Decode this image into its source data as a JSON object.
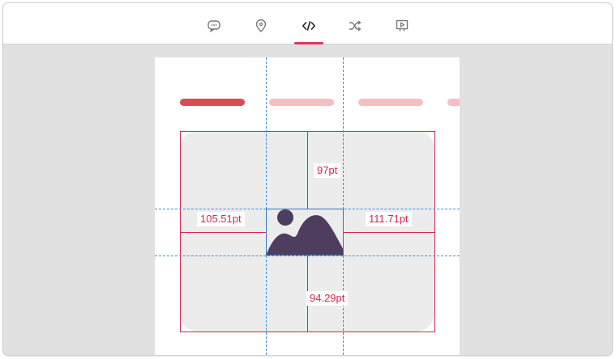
{
  "toolbar": {
    "tabs": [
      {
        "icon": "speech-bubble-icon",
        "active": false
      },
      {
        "icon": "location-pin-icon",
        "active": false
      },
      {
        "icon": "code-icon",
        "active": true
      },
      {
        "icon": "shuffle-icon",
        "active": false
      },
      {
        "icon": "play-presentation-icon",
        "active": false
      }
    ]
  },
  "canvas": {
    "pills": [
      {
        "state": "active",
        "color": "#dc4b55"
      },
      {
        "state": "inactive",
        "color": "#f2c0c3"
      },
      {
        "state": "inactive",
        "color": "#f2c0c3"
      },
      {
        "state": "inactive",
        "color": "#f2c0c3"
      }
    ],
    "measurements": {
      "top": "97pt",
      "left": "105.51pt",
      "right": "111.71pt",
      "bottom": "94.29pt"
    },
    "image_placeholder_icon": "image-mountain-icon"
  },
  "colors": {
    "accent": "#e0365a",
    "measure_line": "#d8264d",
    "guide": "#3a8fd8",
    "image_shape": "#4e3d5e"
  }
}
